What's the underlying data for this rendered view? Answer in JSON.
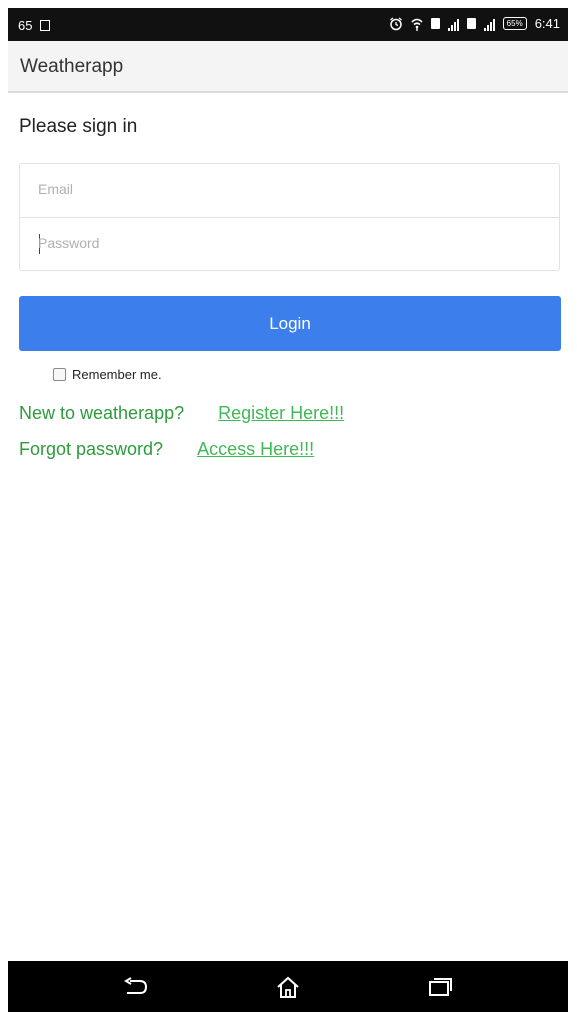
{
  "status_bar": {
    "left_text": "65",
    "battery": "65%",
    "time": "6:41"
  },
  "app_bar": {
    "title": "Weatherapp"
  },
  "form": {
    "heading": "Please sign in",
    "email_placeholder": "Email",
    "password_placeholder": "Password",
    "login_label": "Login",
    "remember_label": "Remember me."
  },
  "links": {
    "register_prompt": "New to weatherapp?",
    "register_link": "Register Here!!!",
    "forgot_prompt": "Forgot password?",
    "forgot_link": "Access Here!!!"
  },
  "colors": {
    "login_button": "#3b7eec",
    "prompt_text": "#2e9b3c",
    "link_text": "#41b857"
  },
  "icons": {
    "notification": "square-notification-icon",
    "alarm": "alarm-clock-icon",
    "wifi": "wifi-icon",
    "signal": "cell-signal-icon",
    "battery": "battery-icon",
    "back": "back-arrow-icon",
    "home": "home-icon",
    "recents": "recent-apps-icon"
  }
}
